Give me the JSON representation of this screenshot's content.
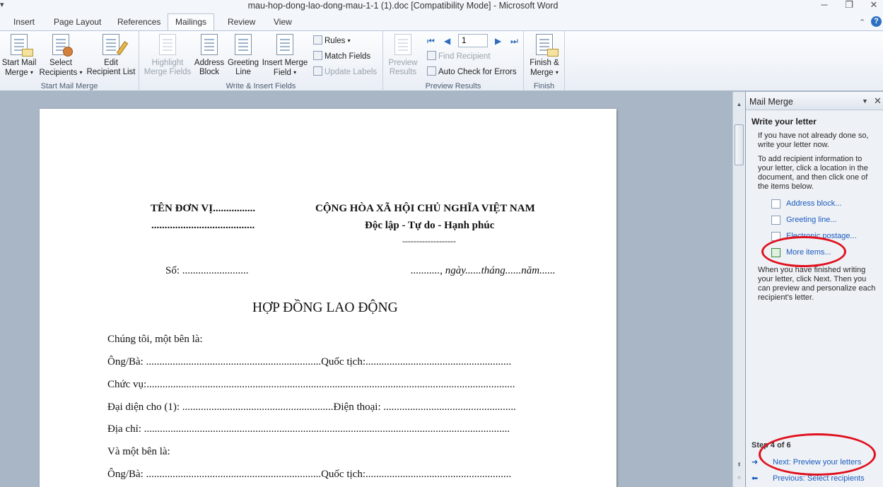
{
  "window": {
    "title": "mau-hop-dong-lao-dong-mau-1-1 (1).doc [Compatibility Mode]  -  Microsoft Word",
    "qat_glyph": "▾",
    "minimize": "─",
    "restore": "❐",
    "close": "✕"
  },
  "tabs": [
    {
      "label": "Insert"
    },
    {
      "label": "Page Layout"
    },
    {
      "label": "References"
    },
    {
      "label": "Mailings",
      "active": true
    },
    {
      "label": "Review"
    },
    {
      "label": "View"
    }
  ],
  "tab_icons": {
    "collapse": "⌃",
    "help": "?"
  },
  "ribbon": {
    "start_mail_merge": {
      "start_line1": "Start Mail",
      "start_line2": "Merge",
      "select_line1": "Select",
      "select_line2": "Recipients",
      "edit_line1": "Edit",
      "edit_line2": "Recipient List",
      "group_label": "Start Mail Merge"
    },
    "write_insert": {
      "highlight_line1": "Highlight",
      "highlight_line2": "Merge Fields",
      "address_line1": "Address",
      "address_line2": "Block",
      "greeting_line1": "Greeting",
      "greeting_line2": "Line",
      "insert_line1": "Insert Merge",
      "insert_line2": "Field",
      "rules": "Rules",
      "match_fields": "Match Fields",
      "update_labels": "Update Labels",
      "group_label": "Write & Insert Fields"
    },
    "preview": {
      "preview_line1": "Preview",
      "preview_line2": "Results",
      "record_value": "1",
      "find_recipient": "Find Recipient",
      "auto_check": "Auto Check for Errors",
      "group_label": "Preview Results",
      "first_arrow": "⏮",
      "prev_arrow": "◀",
      "next_arrow": "▶",
      "last_arrow": "⏭"
    },
    "finish": {
      "finish_line1": "Finish &",
      "finish_line2": "Merge",
      "group_label": "Finish"
    },
    "caret": "▾"
  },
  "document": {
    "org_name": "TÊN ĐƠN VỊ................",
    "org_dots": ".......................................",
    "republic": "CỘNG HÒA XÃ HỘI CHỦ NGHĨA VIỆT NAM",
    "motto": "Độc lập - Tự do - Hạnh phúc",
    "rule": "-------------------",
    "so": "Số: .........................",
    "date": "..........., ngày......tháng......năm......",
    "heading": "HỢP ĐỒNG LAO ĐỘNG",
    "lines": [
      "Chúng tôi, một bên là:",
      "Ông/Bà:  ..................................................................Quốc tịch:.......................................................",
      "Chức vụ:...........................................................................................................................................",
      "Đại diện cho (1):  .........................................................Điện thoại: ..................................................",
      "Địa chỉ:  ..........................................................................................................................................",
      "Và một bên là:",
      "Ông/Bà:  ..................................................................Quốc tịch:......................................................."
    ]
  },
  "scrollbar": {
    "up": "▲",
    "down": "▼",
    "prev_page": "⇞",
    "browse": "○"
  },
  "task_pane": {
    "title": "Mail Merge",
    "dropdown": "▼",
    "close": "✕",
    "section_title": "Write your letter",
    "para1": "If you have not already done so, write your letter now.",
    "para2": "To add recipient information to your letter, click a location in the document, and then click one of the items below.",
    "links": [
      "Address block...",
      "Greeting line...",
      "Electronic postage...",
      "More items..."
    ],
    "para3": "When you have finished writing your letter, click Next. Then you can preview and personalize each recipient's letter.",
    "step": "Step 4 of 6",
    "next": "Next: Preview your letters",
    "previous": "Previous: Select recipients",
    "next_arrow": "➜",
    "prev_arrow": "⬅"
  },
  "annotation_color": "#e0101e"
}
